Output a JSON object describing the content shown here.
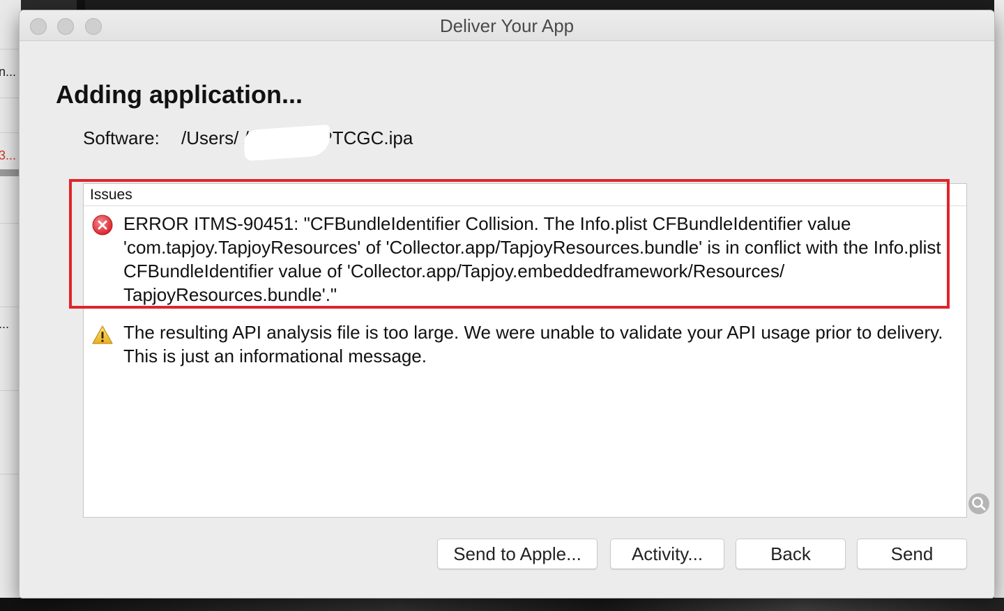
{
  "background": {
    "left_fragments": [
      "n...",
      "3...",
      "..."
    ]
  },
  "window": {
    "title": "Deliver Your App",
    "traffic_lights": [
      "close",
      "minimize",
      "zoom"
    ]
  },
  "main": {
    "heading": "Adding application...",
    "software_label": "Software:",
    "software_path": "/Users/         /Desktop/PTCGC.ipa"
  },
  "issues": {
    "header": "Issues",
    "items": [
      {
        "severity": "error",
        "icon": "error-icon",
        "text": "ERROR ITMS-90451: \"CFBundleIdentifier Collision. The Info.plist CFBundleIdentifier value 'com.tapjoy.TapjoyResources' of 'Collector.app/TapjoyResources.bundle' is in conflict with the Info.plist CFBundleIdentifier value of 'Collector.app/Tapjoy.embeddedframework/Resources/ TapjoyResources.bundle'.\""
      },
      {
        "severity": "warning",
        "icon": "warning-icon",
        "text": "The resulting API analysis file is too large.  We were unable to validate your API usage prior to delivery.  This is just an informational message."
      }
    ]
  },
  "buttons": {
    "send_to_apple": "Send to Apple...",
    "activity": "Activity...",
    "back": "Back",
    "send": "Send"
  },
  "colors": {
    "highlight": "#e0242c",
    "error": "#e2434a",
    "warning": "#f2c230"
  }
}
